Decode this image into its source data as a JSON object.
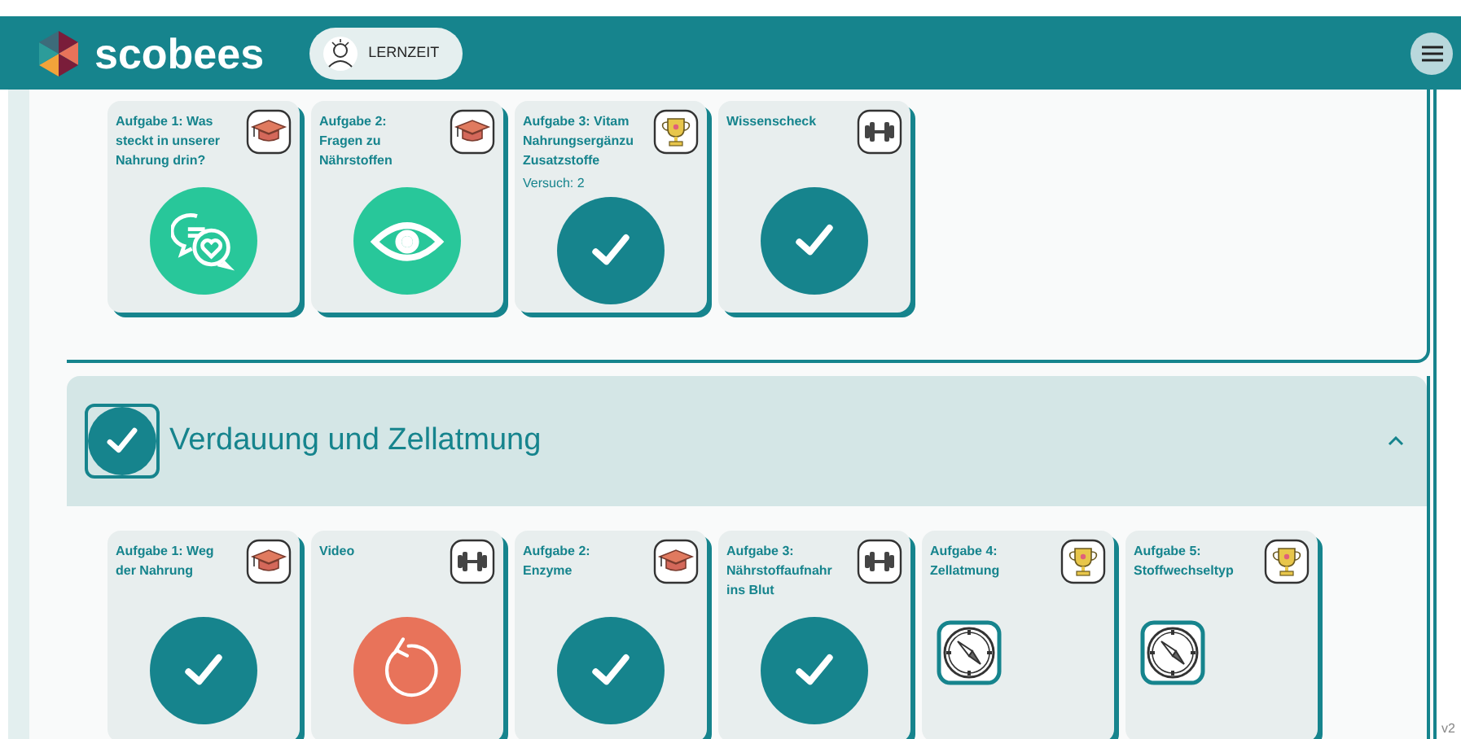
{
  "header": {
    "brand": "scobees",
    "mode_button": "LERNZEIT"
  },
  "sections": [
    {
      "tasks": [
        {
          "title_lines": [
            "Aufgabe 1: Was",
            "steckt in unserer",
            "Nahrung drin?"
          ],
          "badge": {
            "kind": "cap"
          },
          "status": {
            "kind": "chat"
          }
        },
        {
          "title_lines": [
            "Aufgabe 2:",
            "Fragen zu",
            "Nährstoffen"
          ],
          "badge": {
            "kind": "cap"
          },
          "status": {
            "kind": "eye"
          }
        },
        {
          "title_lines": [
            "Aufgabe 3: Vitam",
            "Nahrungsergänzu",
            "Zusatzstoffe"
          ],
          "attempt": "Versuch: 2",
          "badge": {
            "kind": "trophy"
          },
          "status": {
            "kind": "done"
          }
        },
        {
          "title_lines": [
            "Wissenscheck"
          ],
          "badge": {
            "kind": "dumbbell"
          },
          "status": {
            "kind": "done"
          }
        }
      ]
    },
    {
      "title": "Verdauung und Zellatmung",
      "done": true,
      "expanded": true,
      "tasks": [
        {
          "title_lines": [
            "Aufgabe 1: Weg",
            "der Nahrung"
          ],
          "badge": {
            "kind": "cap"
          },
          "status": {
            "kind": "done"
          }
        },
        {
          "title_lines": [
            "Video"
          ],
          "badge": {
            "kind": "dumbbell"
          },
          "status": {
            "kind": "retry"
          }
        },
        {
          "title_lines": [
            "Aufgabe 2:",
            "Enzyme"
          ],
          "badge": {
            "kind": "cap"
          },
          "status": {
            "kind": "done"
          }
        },
        {
          "title_lines": [
            "Aufgabe 3:",
            "Nährstoffaufnahr",
            "ins Blut"
          ],
          "badge": {
            "kind": "dumbbell"
          },
          "status": {
            "kind": "done"
          }
        },
        {
          "title_lines": [
            "Aufgabe 4:",
            "Zellatmung"
          ],
          "badge": {
            "kind": "trophy"
          },
          "status": {
            "kind": "compass"
          }
        },
        {
          "title_lines": [
            "Aufgabe 5:",
            "Stoffwechseltyp"
          ],
          "badge": {
            "kind": "trophy"
          },
          "status": {
            "kind": "compass"
          }
        }
      ]
    }
  ],
  "version": "v2"
}
